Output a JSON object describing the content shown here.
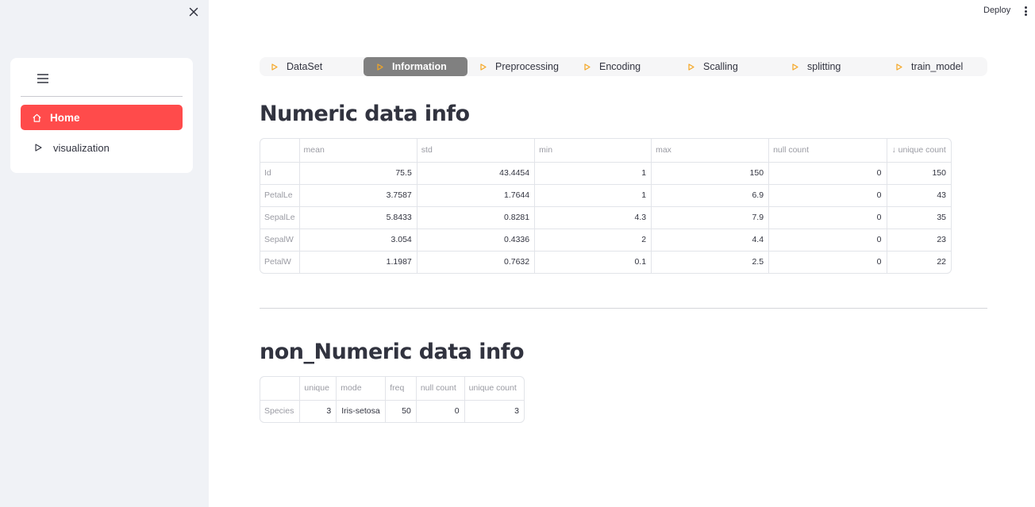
{
  "sidebar": {
    "close_icon": "close-icon",
    "menu_icon": "hamburger-icon",
    "items": [
      {
        "label": "Home",
        "icon": "home-icon",
        "active": true
      },
      {
        "label": "visualization",
        "icon": "play-triangle-icon",
        "active": false
      }
    ]
  },
  "header": {
    "deploy_label": "Deploy",
    "more_icon": "kebab-menu-icon"
  },
  "tabs": [
    {
      "label": "DataSet",
      "active": false
    },
    {
      "label": "Information",
      "active": true
    },
    {
      "label": "Preprocessing",
      "active": false
    },
    {
      "label": "Encoding",
      "active": false
    },
    {
      "label": "Scalling",
      "active": false
    },
    {
      "label": "splitting",
      "active": false
    },
    {
      "label": "train_model",
      "active": false
    }
  ],
  "numeric": {
    "title": "Numeric data info",
    "columns": [
      "",
      "mean",
      "std",
      "min",
      "max",
      "null count",
      "↓ unique count"
    ],
    "rows": [
      [
        "Id",
        "75.5",
        "43.4454",
        "1",
        "150",
        "0",
        "150"
      ],
      [
        "PetalLe",
        "3.7587",
        "1.7644",
        "1",
        "6.9",
        "0",
        "43"
      ],
      [
        "SepalLe",
        "5.8433",
        "0.8281",
        "4.3",
        "7.9",
        "0",
        "35"
      ],
      [
        "SepalW",
        "3.054",
        "0.4336",
        "2",
        "4.4",
        "0",
        "23"
      ],
      [
        "PetalW",
        "1.1987",
        "0.7632",
        "0.1",
        "2.5",
        "0",
        "22"
      ]
    ]
  },
  "non_numeric": {
    "title": "non_Numeric data info",
    "columns": [
      "",
      "unique",
      "mode",
      "freq",
      "null count",
      "unique count"
    ],
    "rows": [
      [
        "Species",
        "3",
        "Iris-setosa",
        "50",
        "0",
        "3"
      ]
    ]
  },
  "colors": {
    "accent": "#ff4b4b",
    "active_tab": "#808080",
    "tab_triangle": "#f5a623",
    "sidebar_bg": "#f0f2f6"
  }
}
